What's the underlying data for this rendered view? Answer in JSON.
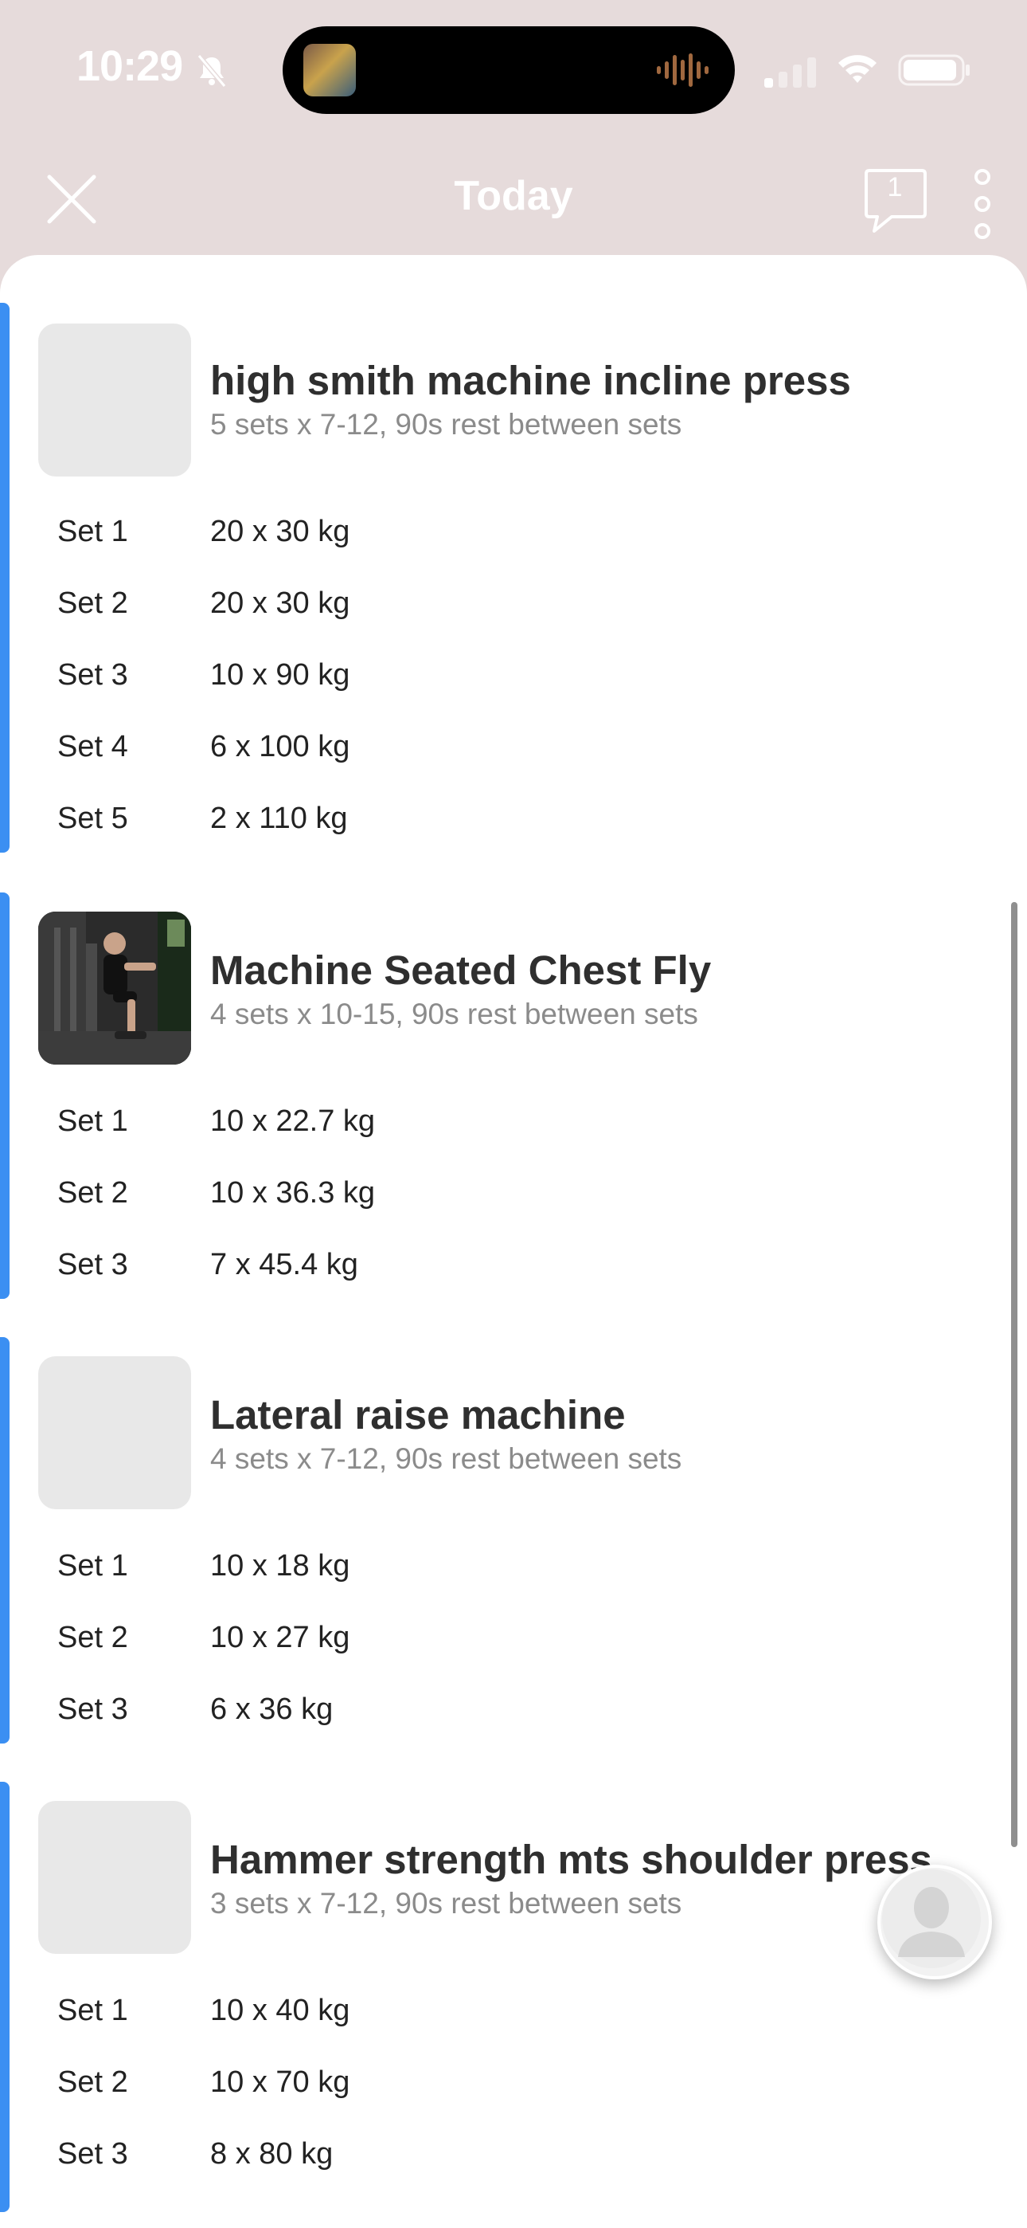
{
  "status_bar": {
    "time": "10:29",
    "island_thumb_label": "'1 Li"
  },
  "nav": {
    "title": "Today",
    "comment_count": "1"
  },
  "colors": {
    "accent": "#3b8ff2",
    "header_bg": "#e6dbdb"
  },
  "exercises": [
    {
      "title": "high smith machine incline press",
      "subtitle": "5 sets x 7-12, 90s rest between sets",
      "has_image": false,
      "sets": [
        {
          "label": "Set 1",
          "value": "20 x 30 kg"
        },
        {
          "label": "Set 2",
          "value": "20 x 30 kg"
        },
        {
          "label": "Set 3",
          "value": "10 x 90 kg"
        },
        {
          "label": "Set 4",
          "value": "6 x 100 kg"
        },
        {
          "label": "Set 5",
          "value": "2 x 110 kg"
        }
      ]
    },
    {
      "title": "Machine Seated Chest Fly",
      "subtitle": "4 sets x 10-15, 90s rest between sets",
      "has_image": true,
      "sets": [
        {
          "label": "Set 1",
          "value": "10 x 22.7 kg"
        },
        {
          "label": "Set 2",
          "value": "10 x 36.3 kg"
        },
        {
          "label": "Set 3",
          "value": "7 x 45.4 kg"
        }
      ]
    },
    {
      "title": "Lateral raise machine",
      "subtitle": "4 sets x 7-12, 90s rest between sets",
      "has_image": false,
      "sets": [
        {
          "label": "Set 1",
          "value": "10 x 18 kg"
        },
        {
          "label": "Set 2",
          "value": "10 x 27 kg"
        },
        {
          "label": "Set 3",
          "value": "6 x 36 kg"
        }
      ]
    },
    {
      "title": "Hammer strength mts shoulder press",
      "subtitle": "3 sets x 7-12, 90s rest between sets",
      "has_image": false,
      "sets": [
        {
          "label": "Set 1",
          "value": "10 x 40 kg"
        },
        {
          "label": "Set 2",
          "value": "10 x 70 kg"
        },
        {
          "label": "Set 3",
          "value": "8 x 80 kg"
        }
      ]
    }
  ]
}
